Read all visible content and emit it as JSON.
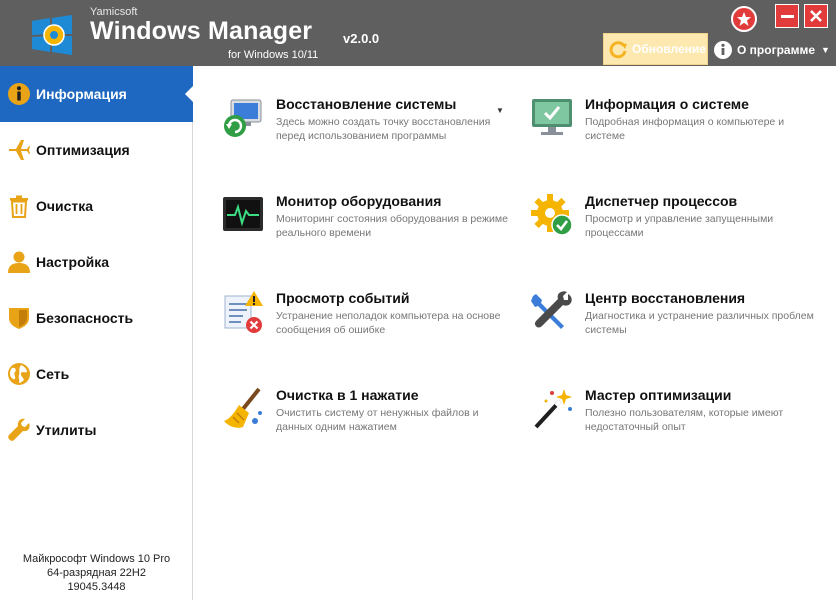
{
  "titlebar": {
    "vendor": "Yamicsoft",
    "app_name": "Windows Manager",
    "version": "v2.0.0",
    "platform": "for Windows 10/11",
    "update_label": "Обновление",
    "about_label": "О программе"
  },
  "sidebar": {
    "items": [
      {
        "label": "Информация",
        "icon": "info-icon"
      },
      {
        "label": "Оптимизация",
        "icon": "airplane-icon"
      },
      {
        "label": "Очистка",
        "icon": "trash-icon"
      },
      {
        "label": "Настройка",
        "icon": "user-icon"
      },
      {
        "label": "Безопасность",
        "icon": "shield-icon"
      },
      {
        "label": "Сеть",
        "icon": "globe-icon"
      },
      {
        "label": "Утилиты",
        "icon": "wrench-icon"
      }
    ],
    "system": {
      "line1": "Майкрософт Windows 10 Pro",
      "line2": "64-разрядная 22H2",
      "line3": "19045.3448"
    }
  },
  "tiles": [
    {
      "title": "Восстановление системы",
      "desc": "Здесь можно создать точку восстановления перед использованием программы",
      "icon": "system-restore-icon"
    },
    {
      "title": "Информация о системе",
      "desc": "Подробная информация о компьютере и системе",
      "icon": "monitor-icon"
    },
    {
      "title": "Монитор оборудования",
      "desc": "Мониторинг состояния оборудования в режиме реального времени",
      "icon": "hardware-monitor-icon"
    },
    {
      "title": "Диспетчер процессов",
      "desc": "Просмотр и управление запущенными процессами",
      "icon": "process-gear-icon"
    },
    {
      "title": "Просмотр событий",
      "desc": "Устранение неполадок компьютера на основе сообщения об ошибке",
      "icon": "event-viewer-icon"
    },
    {
      "title": "Центр восстановления",
      "desc": "Диагностика и устранение различных проблем системы",
      "icon": "repair-tools-icon"
    },
    {
      "title": "Очистка в 1 нажатие",
      "desc": "Очистить систему от ненужных файлов и данных одним нажатием",
      "icon": "broom-icon"
    },
    {
      "title": "Мастер оптимизации",
      "desc": "Полезно пользователям, которые имеют недостаточный опыт",
      "icon": "magic-wand-icon"
    }
  ],
  "colors": {
    "accent": "#1f68c1",
    "titlebar": "#5f5f5f",
    "icon_gold": "#e8a317",
    "close_red": "#e23b3b"
  }
}
